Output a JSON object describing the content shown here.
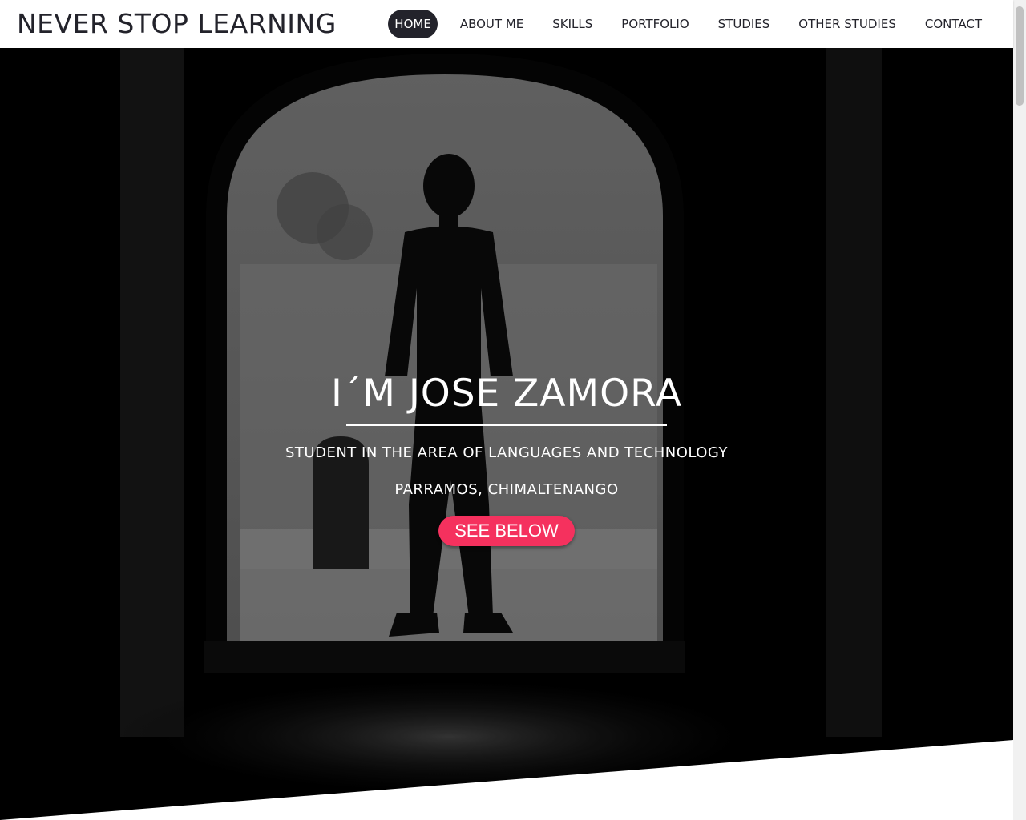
{
  "header": {
    "brand": "NEVER STOP LEARNING",
    "nav": [
      {
        "label": "HOME",
        "active": true
      },
      {
        "label": "ABOUT ME",
        "active": false
      },
      {
        "label": "SKILLS",
        "active": false
      },
      {
        "label": "PORTFOLIO",
        "active": false
      },
      {
        "label": "STUDIES",
        "active": false
      },
      {
        "label": "OTHER STUDIES",
        "active": false
      },
      {
        "label": "CONTACT",
        "active": false
      }
    ]
  },
  "hero": {
    "title": "I´M JOSE ZAMORA",
    "subtitle": "STUDENT IN THE AREA OF LANGUAGES AND TECHNOLOGY",
    "location": "PARRAMOS, CHIMALTENANGO",
    "button_label": "SEE BELOW"
  },
  "colors": {
    "nav_active_bg": "#23232b",
    "accent": "#f5315e",
    "hero_bg": "#000000"
  },
  "icons": []
}
